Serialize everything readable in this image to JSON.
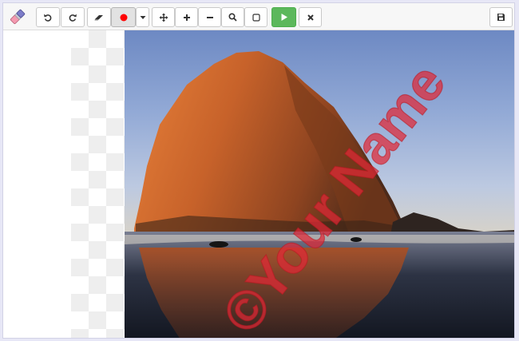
{
  "toolbar": {
    "app_icon": "eraser-logo-icon",
    "buttons": [
      {
        "name": "undo-button",
        "icon": "undo-icon"
      },
      {
        "name": "redo-button",
        "icon": "redo-icon"
      },
      {
        "name": "eraser-button",
        "icon": "eraser-icon"
      },
      {
        "name": "color-button",
        "icon": "record-dot-icon",
        "color": "#ff0000"
      },
      {
        "name": "color-dropdown-button",
        "icon": "caret-down-icon"
      },
      {
        "name": "move-button",
        "icon": "move-arrows-icon"
      },
      {
        "name": "zoom-in-button",
        "icon": "plus-icon"
      },
      {
        "name": "zoom-out-button",
        "icon": "minus-icon"
      },
      {
        "name": "search-button",
        "icon": "magnifier-icon"
      },
      {
        "name": "fit-button",
        "icon": "square-icon"
      },
      {
        "name": "apply-button",
        "icon": "play-icon"
      },
      {
        "name": "close-button",
        "icon": "times-icon"
      },
      {
        "name": "save-button",
        "icon": "floppy-disk-icon"
      }
    ]
  },
  "canvas": {
    "watermark_text": "©Your Name",
    "watermark_color": "#e02836",
    "checker_color": "#eeeeee",
    "accent_green": "#5cb85c"
  }
}
